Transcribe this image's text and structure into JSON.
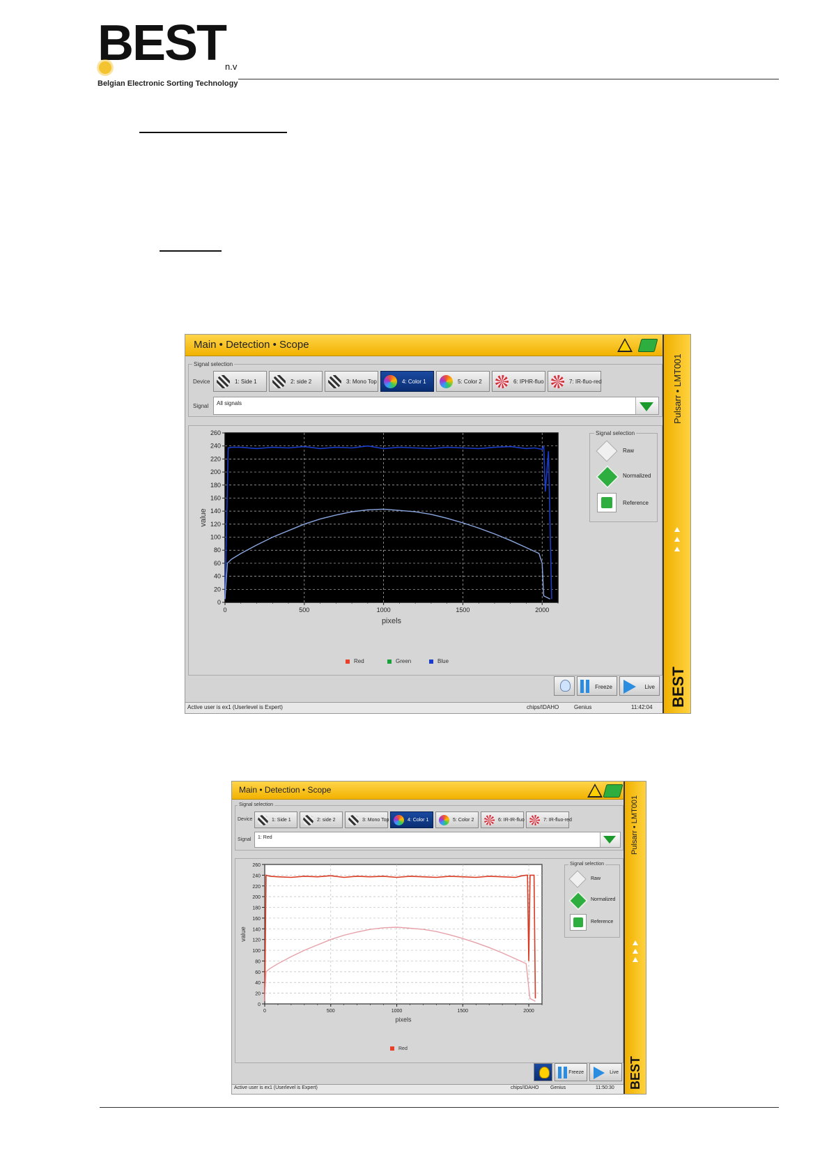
{
  "logo": {
    "main": "BEST",
    "suffix": "n.v",
    "tagline": "Belgian Electronic Sorting Technology"
  },
  "screens": [
    {
      "breadcrumb": "Main • Detection • Scope",
      "signal_selection_label": "Signal selection",
      "device_label": "Device",
      "devices": [
        {
          "label": "1: Side 1",
          "icon": "mono-camera-icon",
          "active": false
        },
        {
          "label": "2: side 2",
          "icon": "mono-camera-icon",
          "active": false
        },
        {
          "label": "3: Mono Top",
          "icon": "mono-camera-icon",
          "active": false
        },
        {
          "label": "4: Color 1",
          "icon": "color-camera-icon",
          "active": true
        },
        {
          "label": "5: Color 2",
          "icon": "color-camera-icon",
          "active": false
        },
        {
          "label": "6: IPHR-fluo",
          "icon": "fluo-camera-icon",
          "active": false
        },
        {
          "label": "7: IR-fluo-red",
          "icon": "fluo-camera-icon",
          "active": false
        }
      ],
      "signal_label": "Signal",
      "signal_value": "All signals",
      "options_title": "Signal selection",
      "options": [
        "Raw",
        "Normalized",
        "Reference"
      ],
      "legend": [
        {
          "name": "Red",
          "color": "#e8402a"
        },
        {
          "name": "Green",
          "color": "#1aa03a"
        },
        {
          "name": "Blue",
          "color": "#1a3cc8"
        }
      ],
      "freeze_label": "Freeze",
      "live_label": "Live",
      "status": {
        "user": "Active user is ex1 (Userlevel is Expert)",
        "product": "chips/IDAHO",
        "mode": "Genius",
        "time": "11:42:04"
      },
      "machine": "Pulsarr • LMT001",
      "brand": "BEST",
      "chart_data": {
        "type": "line",
        "xlabel": "pixels",
        "ylabel": "value",
        "xlim": [
          0,
          2100
        ],
        "ylim": [
          0,
          260
        ],
        "x_ticks": [
          0,
          500,
          1000,
          1500,
          2000
        ],
        "y_ticks": [
          0,
          20,
          40,
          60,
          80,
          100,
          120,
          140,
          160,
          180,
          200,
          220,
          240,
          260
        ],
        "background": "#000000",
        "grid": true,
        "series": [
          {
            "name": "Blue",
            "kind": "raw",
            "color": "#1a3cc8",
            "x": [
              0,
              20,
              40,
              100,
              200,
              300,
              400,
              500,
              600,
              700,
              800,
              900,
              1000,
              1100,
              1200,
              1300,
              1400,
              1500,
              1600,
              1700,
              1800,
              1900,
              1950,
              2000,
              2010,
              2020,
              2040,
              2060
            ],
            "y": [
              5,
              237,
              238,
              238,
              236,
              238,
              237,
              239,
              236,
              238,
              237,
              240,
              236,
              238,
              237,
              236,
              238,
              237,
              236,
              238,
              239,
              236,
              237,
              235,
              240,
              170,
              232,
              5
            ]
          },
          {
            "name": "Reference",
            "kind": "reference",
            "color": "#8aa6e0",
            "x": [
              0,
              15,
              40,
              100,
              200,
              300,
              400,
              500,
              600,
              700,
              800,
              900,
              1000,
              1100,
              1200,
              1300,
              1400,
              1500,
              1600,
              1700,
              1800,
              1900,
              1980,
              2000,
              2010,
              2050
            ],
            "y": [
              5,
              60,
              66,
              75,
              88,
              100,
              110,
              120,
              128,
              134,
              139,
              142,
              143,
              141,
              139,
              135,
              129,
              122,
              114,
              105,
              95,
              84,
              75,
              60,
              10,
              5
            ]
          }
        ]
      }
    },
    {
      "breadcrumb": "Main • Detection • Scope",
      "signal_selection_label": "Signal selection",
      "device_label": "Device",
      "devices": [
        {
          "label": "1: Side 1",
          "icon": "mono-camera-icon",
          "active": false
        },
        {
          "label": "2: side 2",
          "icon": "mono-camera-icon",
          "active": false
        },
        {
          "label": "3: Mono Top",
          "icon": "mono-camera-icon",
          "active": false
        },
        {
          "label": "4: Color 1",
          "icon": "color-camera-icon",
          "active": true
        },
        {
          "label": "5: Color 2",
          "icon": "color-camera-icon",
          "active": false
        },
        {
          "label": "6: IR-IR-fluo",
          "icon": "fluo-camera-icon",
          "active": false
        },
        {
          "label": "7: IR-fluo-red",
          "icon": "fluo-camera-icon",
          "active": false
        }
      ],
      "signal_label": "Signal",
      "signal_value": "1: Red",
      "options_title": "Signal selection",
      "options": [
        "Raw",
        "Normalized",
        "Reference"
      ],
      "legend": [
        {
          "name": "Red",
          "color": "#e8402a"
        }
      ],
      "freeze_label": "Freeze",
      "live_label": "Live",
      "status": {
        "user": "Active user is ex1 (Userlevel is Expert)",
        "product": "chips/IDAHO",
        "mode": "Genius",
        "time": "11:50:30"
      },
      "machine": "Pulsarr • LMT001",
      "brand": "BEST",
      "chart_data": {
        "type": "line",
        "xlabel": "pixels",
        "ylabel": "value",
        "xlim": [
          0,
          2100
        ],
        "ylim": [
          0,
          260
        ],
        "x_ticks": [
          0,
          500,
          1000,
          1500,
          2000
        ],
        "y_ticks": [
          0,
          20,
          40,
          60,
          80,
          100,
          120,
          140,
          160,
          180,
          200,
          220,
          240,
          260
        ],
        "background": "#ffffff",
        "grid": true,
        "series": [
          {
            "name": "Red",
            "kind": "raw",
            "color": "#d83a22",
            "x": [
              0,
              10,
              40,
              100,
              200,
              300,
              400,
              500,
              600,
              700,
              800,
              900,
              1000,
              1100,
              1200,
              1300,
              1400,
              1500,
              1600,
              1700,
              1800,
              1900,
              1950,
              1980,
              1990,
              2000,
              2010,
              2020,
              2040,
              2050
            ],
            "y": [
              5,
              240,
              238,
              237,
              236,
              238,
              237,
              239,
              236,
              238,
              237,
              238,
              236,
              238,
              237,
              236,
              238,
              237,
              236,
              238,
              237,
              236,
              239,
              240,
              240,
              80,
              240,
              240,
              240,
              10
            ]
          },
          {
            "name": "Reference",
            "kind": "reference",
            "color": "#e8a0a8",
            "x": [
              0,
              10,
              40,
              100,
              200,
              300,
              400,
              500,
              600,
              700,
              800,
              900,
              1000,
              1100,
              1200,
              1300,
              1400,
              1500,
              1600,
              1700,
              1800,
              1900,
              1980,
              2000,
              2010,
              2050
            ],
            "y": [
              5,
              60,
              66,
              75,
              88,
              100,
              110,
              120,
              128,
              134,
              139,
              142,
              143,
              141,
              139,
              135,
              129,
              122,
              114,
              105,
              95,
              84,
              75,
              30,
              10,
              5
            ]
          }
        ]
      }
    }
  ]
}
